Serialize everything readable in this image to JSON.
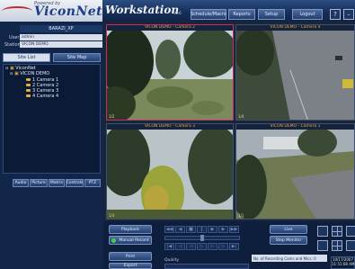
{
  "header": {
    "logo_small": "Powered by",
    "logo_text": "ViconNet",
    "app_title": "Workstation",
    "version": "v1.6",
    "nav": [
      "Schedule/Macro",
      "Reports",
      "Setup",
      "Logout"
    ],
    "icons": [
      "help-icon",
      "minimize-icon"
    ]
  },
  "login": {
    "server": "BARAZI_XP",
    "user_label": "User",
    "user_value": "admin",
    "station_label": "Station",
    "station_value": "VICON DEMO"
  },
  "tabs": {
    "active": "Site List",
    "inactive": "Site Map"
  },
  "tree": {
    "root": "ViconNet",
    "site": "VICON DEMO",
    "cameras": [
      "1  Camera 1",
      "2  Camera 2",
      "3  Camera 3",
      "4  Camera 4"
    ]
  },
  "bottom_tabs": [
    "Audio",
    "Picture",
    "Matrix",
    "Controls",
    "PTZ"
  ],
  "cameras": [
    {
      "title": "VICON DEMO - Camera 2",
      "badge": "1/2"
    },
    {
      "title": "VICON DEMO - Camera 4",
      "badge": "1/4"
    },
    {
      "title": "VICON DEMO - Camera 3",
      "badge": "1/3"
    },
    {
      "title": "VICON DEMO - Camera 1",
      "badge": "1/1"
    }
  ],
  "controls": {
    "playback": "Playback",
    "manual_record": "Manual Record",
    "print": "Print",
    "export": "Export",
    "quality_label": "Quality",
    "live": "Live",
    "stop_monitor": "Stop Monitor",
    "recording_label": "No. of Recording Cams and Mics: 0",
    "date": "10/17/2007",
    "time": "11:51:08 AM"
  },
  "colors": {
    "accent_orange": "#f2a640",
    "active_frame": "#c0306a",
    "record_green": "#3fd14a"
  }
}
